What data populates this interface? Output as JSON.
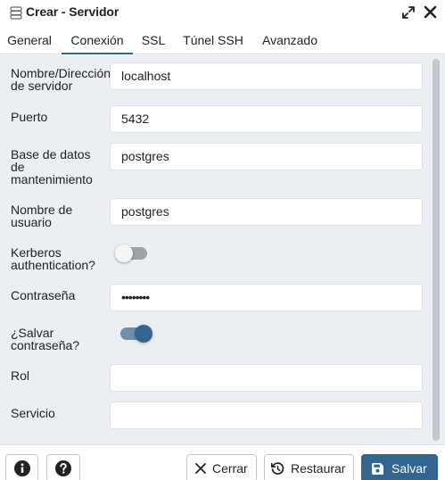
{
  "window": {
    "title": "Crear - Servidor"
  },
  "tabs": [
    {
      "label": "General"
    },
    {
      "label": "Conexión"
    },
    {
      "label": "SSL"
    },
    {
      "label": "Túnel SSH"
    },
    {
      "label": "Avanzado"
    }
  ],
  "active_tab": "Conexión",
  "form": {
    "host_label": "Nombre/Dirección\nde servidor",
    "host_value": "localhost",
    "port_label": "Puerto",
    "port_value": "5432",
    "maintenance_db_label": "Base de datos\nde\nmantenimiento",
    "maintenance_db_value": "postgres",
    "username_label": "Nombre de\nusuario",
    "username_value": "postgres",
    "kerberos_label": "Kerberos\nauthentication?",
    "kerberos_enabled": false,
    "password_label": "Contraseña",
    "password_value": "••••••••",
    "save_password_label": "¿Salvar\ncontraseña?",
    "save_password_enabled": true,
    "role_label": "Rol",
    "role_value": "",
    "service_label": "Servicio",
    "service_value": ""
  },
  "footer": {
    "close_label": "Cerrar",
    "reset_label": "Restaurar",
    "save_label": "Salvar"
  },
  "colors": {
    "accent": "#326690",
    "content_bg": "#ebeef3"
  }
}
